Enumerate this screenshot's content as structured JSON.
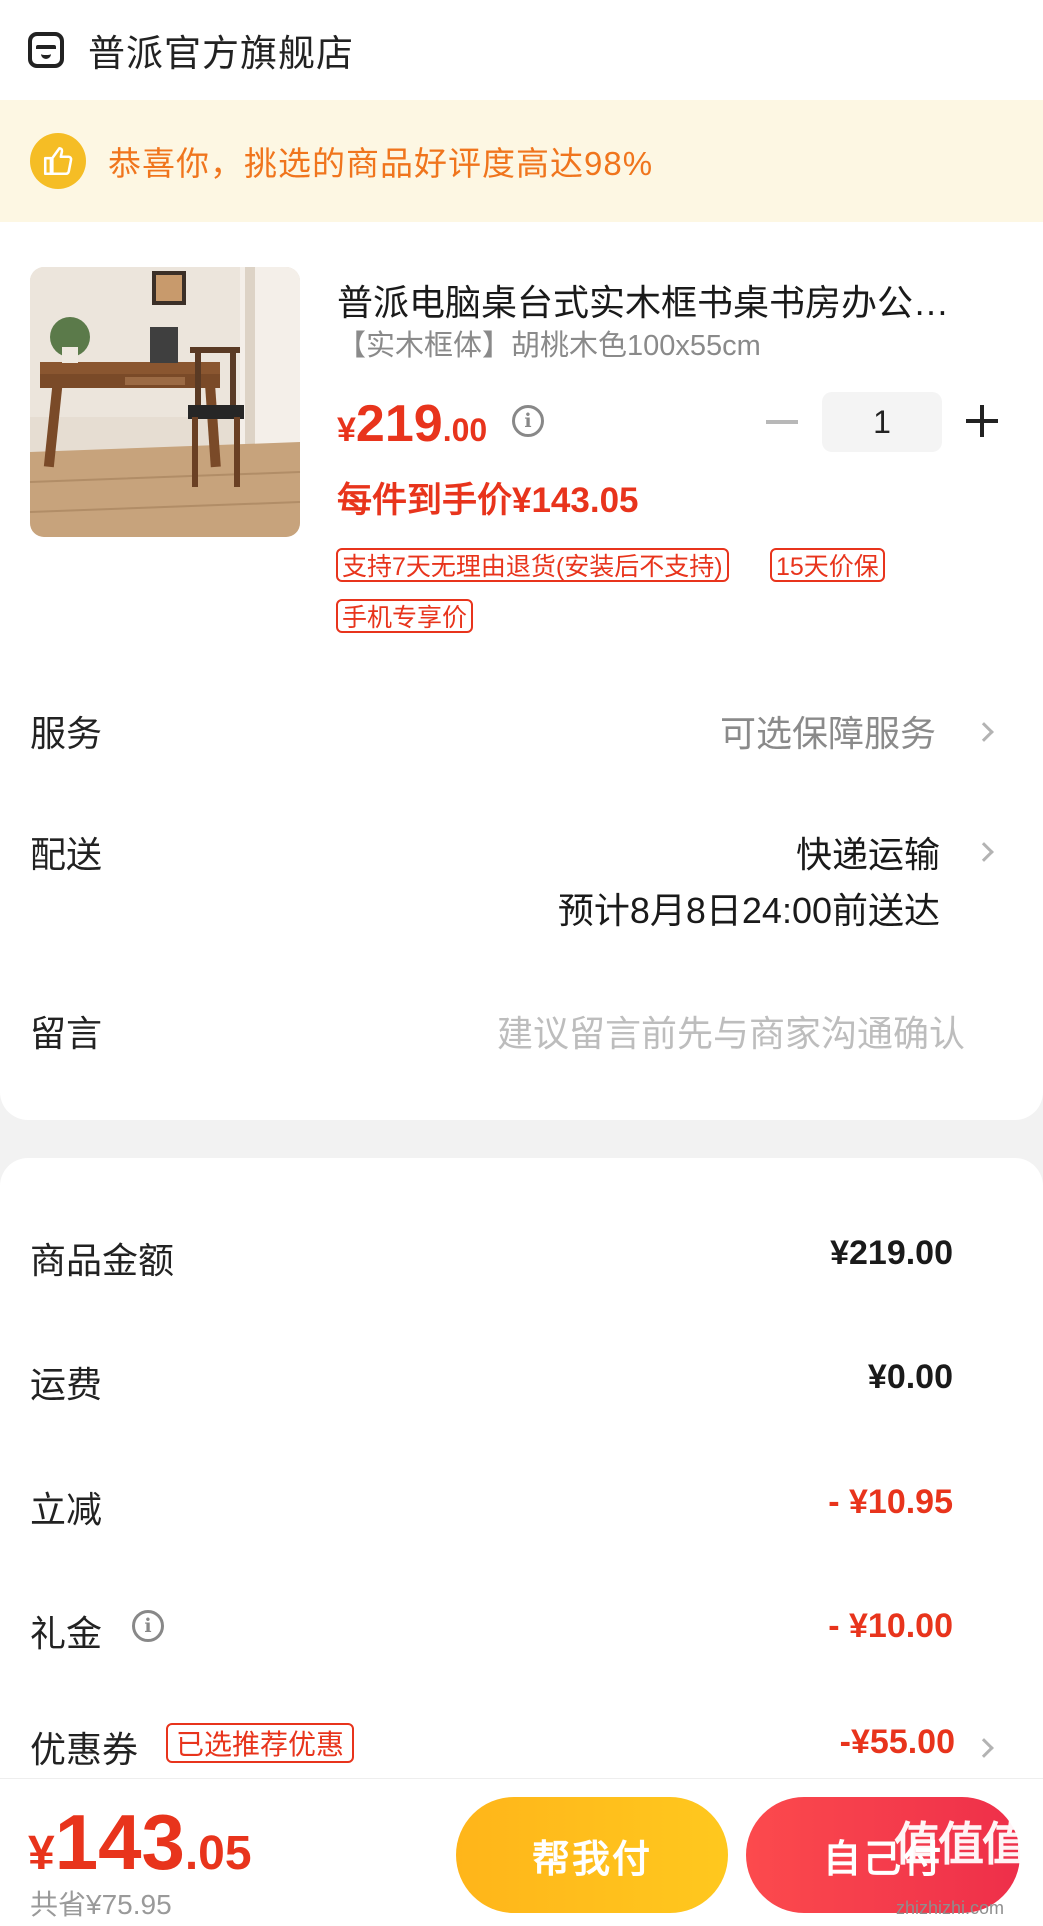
{
  "store": {
    "name": "普派官方旗舰店",
    "icon": "store-icon"
  },
  "banner": {
    "text": "恭喜你，挑选的商品好评度高达98%",
    "icon": "thumbs-up-icon"
  },
  "product": {
    "title": "普派电脑桌台式实木框书桌书房办公…",
    "spec": "【实木框体】胡桃木色100x55cm",
    "price_currency": "¥",
    "price_int": "219",
    "price_dec": ".00",
    "quantity": "1",
    "unit_price": "每件到手价¥143.05",
    "tags": [
      "支持7天无理由退货(安装后不支持)",
      "15天价保",
      "手机专享价"
    ]
  },
  "rows": {
    "service_label": "服务",
    "service_value": "可选保障服务",
    "delivery_label": "配送",
    "delivery_value": "快递运输",
    "delivery_eta": "预计8月8日24:00前送达",
    "note_label": "留言",
    "note_placeholder": "建议留言前先与商家沟通确认"
  },
  "summary": {
    "goods_label": "商品金额",
    "goods_value": "¥219.00",
    "shipping_label": "运费",
    "shipping_value": "¥0.00",
    "discount_label": "立减",
    "discount_value": "- ¥10.95",
    "gift_label": "礼金",
    "gift_value": "- ¥10.00",
    "coupon_label": "优惠券",
    "coupon_tag": "已选推荐优惠",
    "coupon_value": "-¥55.00"
  },
  "footer": {
    "total_currency": "¥",
    "total_int": "143",
    "total_dec": ".05",
    "saved": "共省¥75.95",
    "help_pay": "帮我付",
    "self_pay": "自己付"
  },
  "watermark": {
    "text": "值值值",
    "url": "zhizhizhi.com"
  },
  "colors": {
    "accent_red": "#e8341c",
    "banner_orange": "#f0751d",
    "help_button": "#ffb51a",
    "pay_button": "#f43a4b"
  }
}
